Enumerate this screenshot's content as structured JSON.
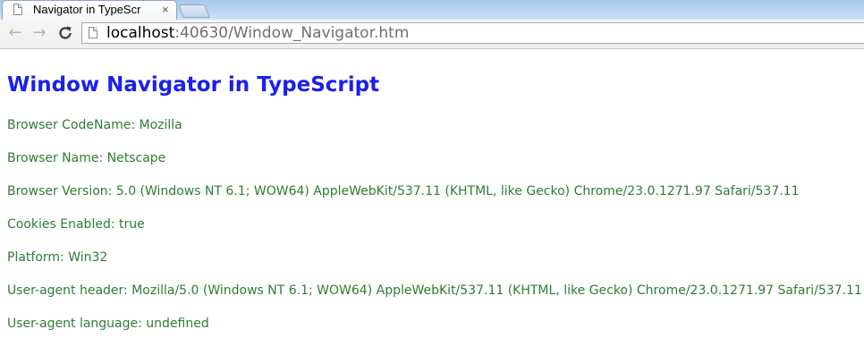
{
  "browser": {
    "tab": {
      "title": "Navigator in TypeScr",
      "close_glyph": "×",
      "page_icon": "page-icon"
    },
    "toolbar": {
      "back_glyph": "←",
      "forward_glyph": "→",
      "reload_glyph": "C",
      "url_host": "localhost",
      "url_rest": ":40630/Window_Navigator.htm"
    }
  },
  "page": {
    "heading": "Window Navigator in TypeScript",
    "heading_color": "#1c20ea",
    "text_color": "#2e7d32",
    "lines": [
      "Browser CodeName: Mozilla",
      "Browser Name: Netscape",
      "Browser Version: 5.0 (Windows NT 6.1; WOW64) AppleWebKit/537.11 (KHTML, like Gecko) Chrome/23.0.1271.97 Safari/537.11",
      "Cookies Enabled: true",
      "Platform: Win32",
      "User-agent header: Mozilla/5.0 (Windows NT 6.1; WOW64) AppleWebKit/537.11 (KHTML, like Gecko) Chrome/23.0.1271.97 Safari/537.11",
      "User-agent language: undefined"
    ]
  }
}
